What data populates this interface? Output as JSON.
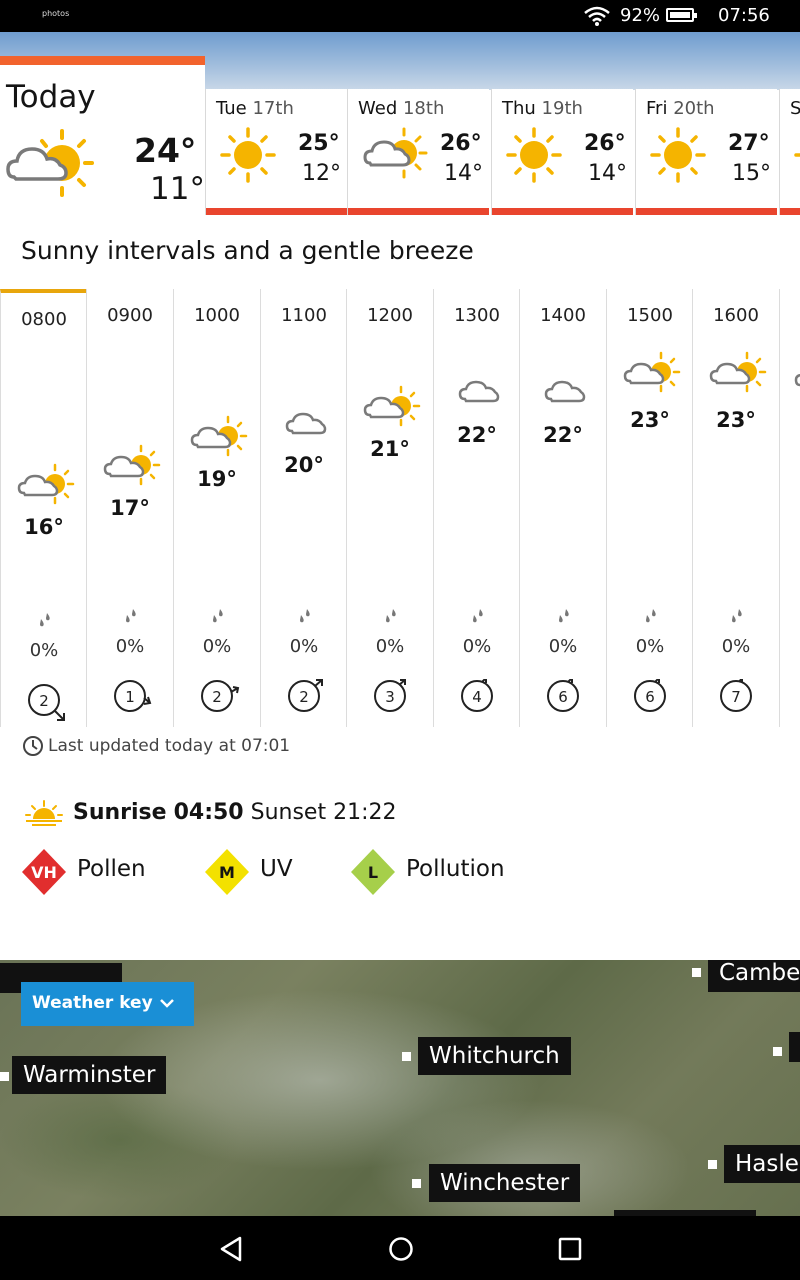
{
  "status_bar": {
    "brand": "photos",
    "battery": "92%",
    "time": "07:56"
  },
  "today": {
    "label": "Today",
    "icon": "sun-cloud-icon",
    "high": "24°",
    "low": "11°"
  },
  "days": [
    {
      "day": "Tue",
      "date": "17th",
      "icon": "sun-icon",
      "high": "25°",
      "low": "12°"
    },
    {
      "day": "Wed",
      "date": "18th",
      "icon": "sun-cloud-icon",
      "high": "26°",
      "low": "14°"
    },
    {
      "day": "Thu",
      "date": "19th",
      "icon": "sun-icon",
      "high": "26°",
      "low": "14°"
    },
    {
      "day": "Fri",
      "date": "20th",
      "icon": "sun-icon",
      "high": "27°",
      "low": "15°"
    },
    {
      "day": "S",
      "date": "",
      "icon": "sun-icon",
      "high": "",
      "low": ""
    }
  ],
  "summary": "Sunny intervals and a gentle breeze",
  "hourly": [
    {
      "time": "0800",
      "icon": "sun-cloud-icon",
      "temp": "16°",
      "rain": "0%",
      "wind": "2"
    },
    {
      "time": "0900",
      "icon": "sun-cloud-icon",
      "temp": "17°",
      "rain": "0%",
      "wind": "1"
    },
    {
      "time": "1000",
      "icon": "sun-cloud-icon",
      "temp": "19°",
      "rain": "0%",
      "wind": "2"
    },
    {
      "time": "1100",
      "icon": "cloud-icon",
      "temp": "20°",
      "rain": "0%",
      "wind": "2"
    },
    {
      "time": "1200",
      "icon": "sun-cloud-icon",
      "temp": "21°",
      "rain": "0%",
      "wind": "3"
    },
    {
      "time": "1300",
      "icon": "cloud-icon",
      "temp": "22°",
      "rain": "0%",
      "wind": "4"
    },
    {
      "time": "1400",
      "icon": "cloud-icon",
      "temp": "22°",
      "rain": "0%",
      "wind": "6"
    },
    {
      "time": "1500",
      "icon": "sun-cloud-icon",
      "temp": "23°",
      "rain": "0%",
      "wind": "6"
    },
    {
      "time": "1600",
      "icon": "sun-cloud-icon",
      "temp": "23°",
      "rain": "0%",
      "wind": "7"
    }
  ],
  "last_updated": "Last updated today at 07:01",
  "sun": {
    "sunrise_label": "Sunrise",
    "sunrise": "04:50",
    "sunset_label": "Sunset",
    "sunset": "21:22"
  },
  "indices": [
    {
      "code": "VH",
      "label": "Pollen",
      "color": "#e12e2e",
      "text_color": "#ffffff"
    },
    {
      "code": "M",
      "label": "UV",
      "color": "#f3e100",
      "text_color": "#141414"
    },
    {
      "code": "L",
      "label": "Pollution",
      "color": "#a6cf4a",
      "text_color": "#141414"
    }
  ],
  "map": {
    "weather_key": "Weather key",
    "towns": [
      "Camber",
      "Warminster",
      "Whitchurch",
      "Winchester",
      "Hasler"
    ]
  },
  "colors": {
    "today_accent": "#f2632d",
    "day_bar": "#e9452e",
    "active_hour": "#e8a60c",
    "weather_key_bg": "#1a8fd6"
  }
}
